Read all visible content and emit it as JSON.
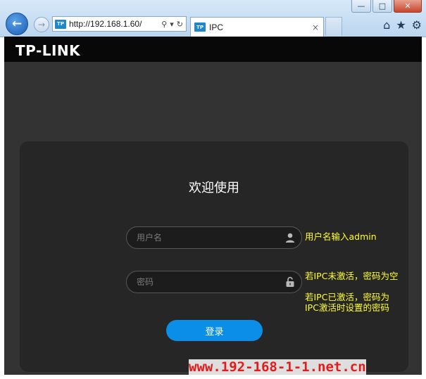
{
  "browser": {
    "url": "http://192.168.1.60/",
    "favicon_text": "TP",
    "tab_title": "IPC",
    "tab_close": "×",
    "win_minimize": "—",
    "win_maximize": "□",
    "win_close": "✕"
  },
  "page": {
    "logo": "TP-LINK",
    "welcome": "欢迎使用",
    "username_placeholder": "用户名",
    "password_placeholder": "密码",
    "login_label": "登录"
  },
  "annotations": {
    "user": "用户名输入admin",
    "pass_not_activated": "若IPC未激活，密码为空",
    "pass_activated_line1": "若IPC已激活，密码为",
    "pass_activated_line2": "IPC激活时设置的密码"
  },
  "watermark": "www.192-168-1-1.net.cn",
  "colors": {
    "accent": "#0a8ee8",
    "annotation": "#ffff33",
    "watermark": "#e31b1b"
  }
}
